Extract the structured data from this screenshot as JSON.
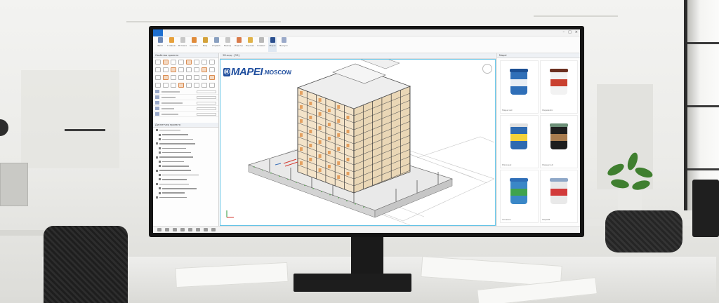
{
  "app": {
    "title": "",
    "ribbon_buttons": [
      {
        "label": "Файл",
        "icon": "file-icon",
        "color": "#6b87b5"
      },
      {
        "label": "Главная",
        "icon": "home-icon",
        "color": "#e7a13c"
      },
      {
        "label": "Вставка",
        "icon": "insert-icon",
        "color": "#c7c7c7"
      },
      {
        "label": "Аннотации",
        "icon": "annotate-icon",
        "color": "#e08b3a"
      },
      {
        "label": "Вид",
        "icon": "view-icon",
        "color": "#d4a23a"
      },
      {
        "label": "Управление",
        "icon": "manage-icon",
        "color": "#8aa0c0"
      },
      {
        "label": "Вывод",
        "icon": "output-icon",
        "color": "#c7c7c7"
      },
      {
        "label": "Надстройки",
        "icon": "addins-icon",
        "color": "#d97b4a"
      },
      {
        "label": "Express",
        "icon": "express-icon",
        "color": "#e0b34a"
      },
      {
        "label": "Совместно",
        "icon": "collab-icon",
        "color": "#b8b8b8"
      },
      {
        "label": "Mapei",
        "icon": "mapei-icon",
        "color": "#2a4f8f"
      },
      {
        "label": "Выпуск",
        "icon": "release-icon",
        "color": "#9aa9c9"
      }
    ],
    "active_ribbon_index": 10
  },
  "left_pane": {
    "properties_title": "Свойства проекта",
    "browser_title": "Диспетчер проекта"
  },
  "canvas": {
    "tab_label": "3D-вид: {3D}"
  },
  "logo": {
    "mark": "Ⓜ",
    "brand": "MAPEI",
    "city": ".MOSCOW"
  },
  "right_pane": {
    "title": "Mapei",
    "products": [
      {
        "caption": "Mapecoat",
        "body": "#2f6fb8",
        "lid": "#1b4f93",
        "band": "#e9eef4"
      },
      {
        "caption": "Mapelastic",
        "body": "#f2f2f2",
        "lid": "#6a2f1f",
        "band": "#c9402f"
      },
      {
        "caption": "Planiseal",
        "body": "#2e6ab0",
        "lid": "#e1e1e1",
        "band": "#f4d23a"
      },
      {
        "caption": "Mapegrout",
        "body": "#1e1e1e",
        "lid": "#6c8f77",
        "band": "#a87c4f"
      },
      {
        "caption": "Idrosilex",
        "body": "#3a87c7",
        "lid": "#2f6fb8",
        "band": "#3fa34d"
      },
      {
        "caption": "Mapefill",
        "body": "#e9e9e9",
        "lid": "#8fa8c8",
        "band": "#d23b3b"
      }
    ]
  }
}
